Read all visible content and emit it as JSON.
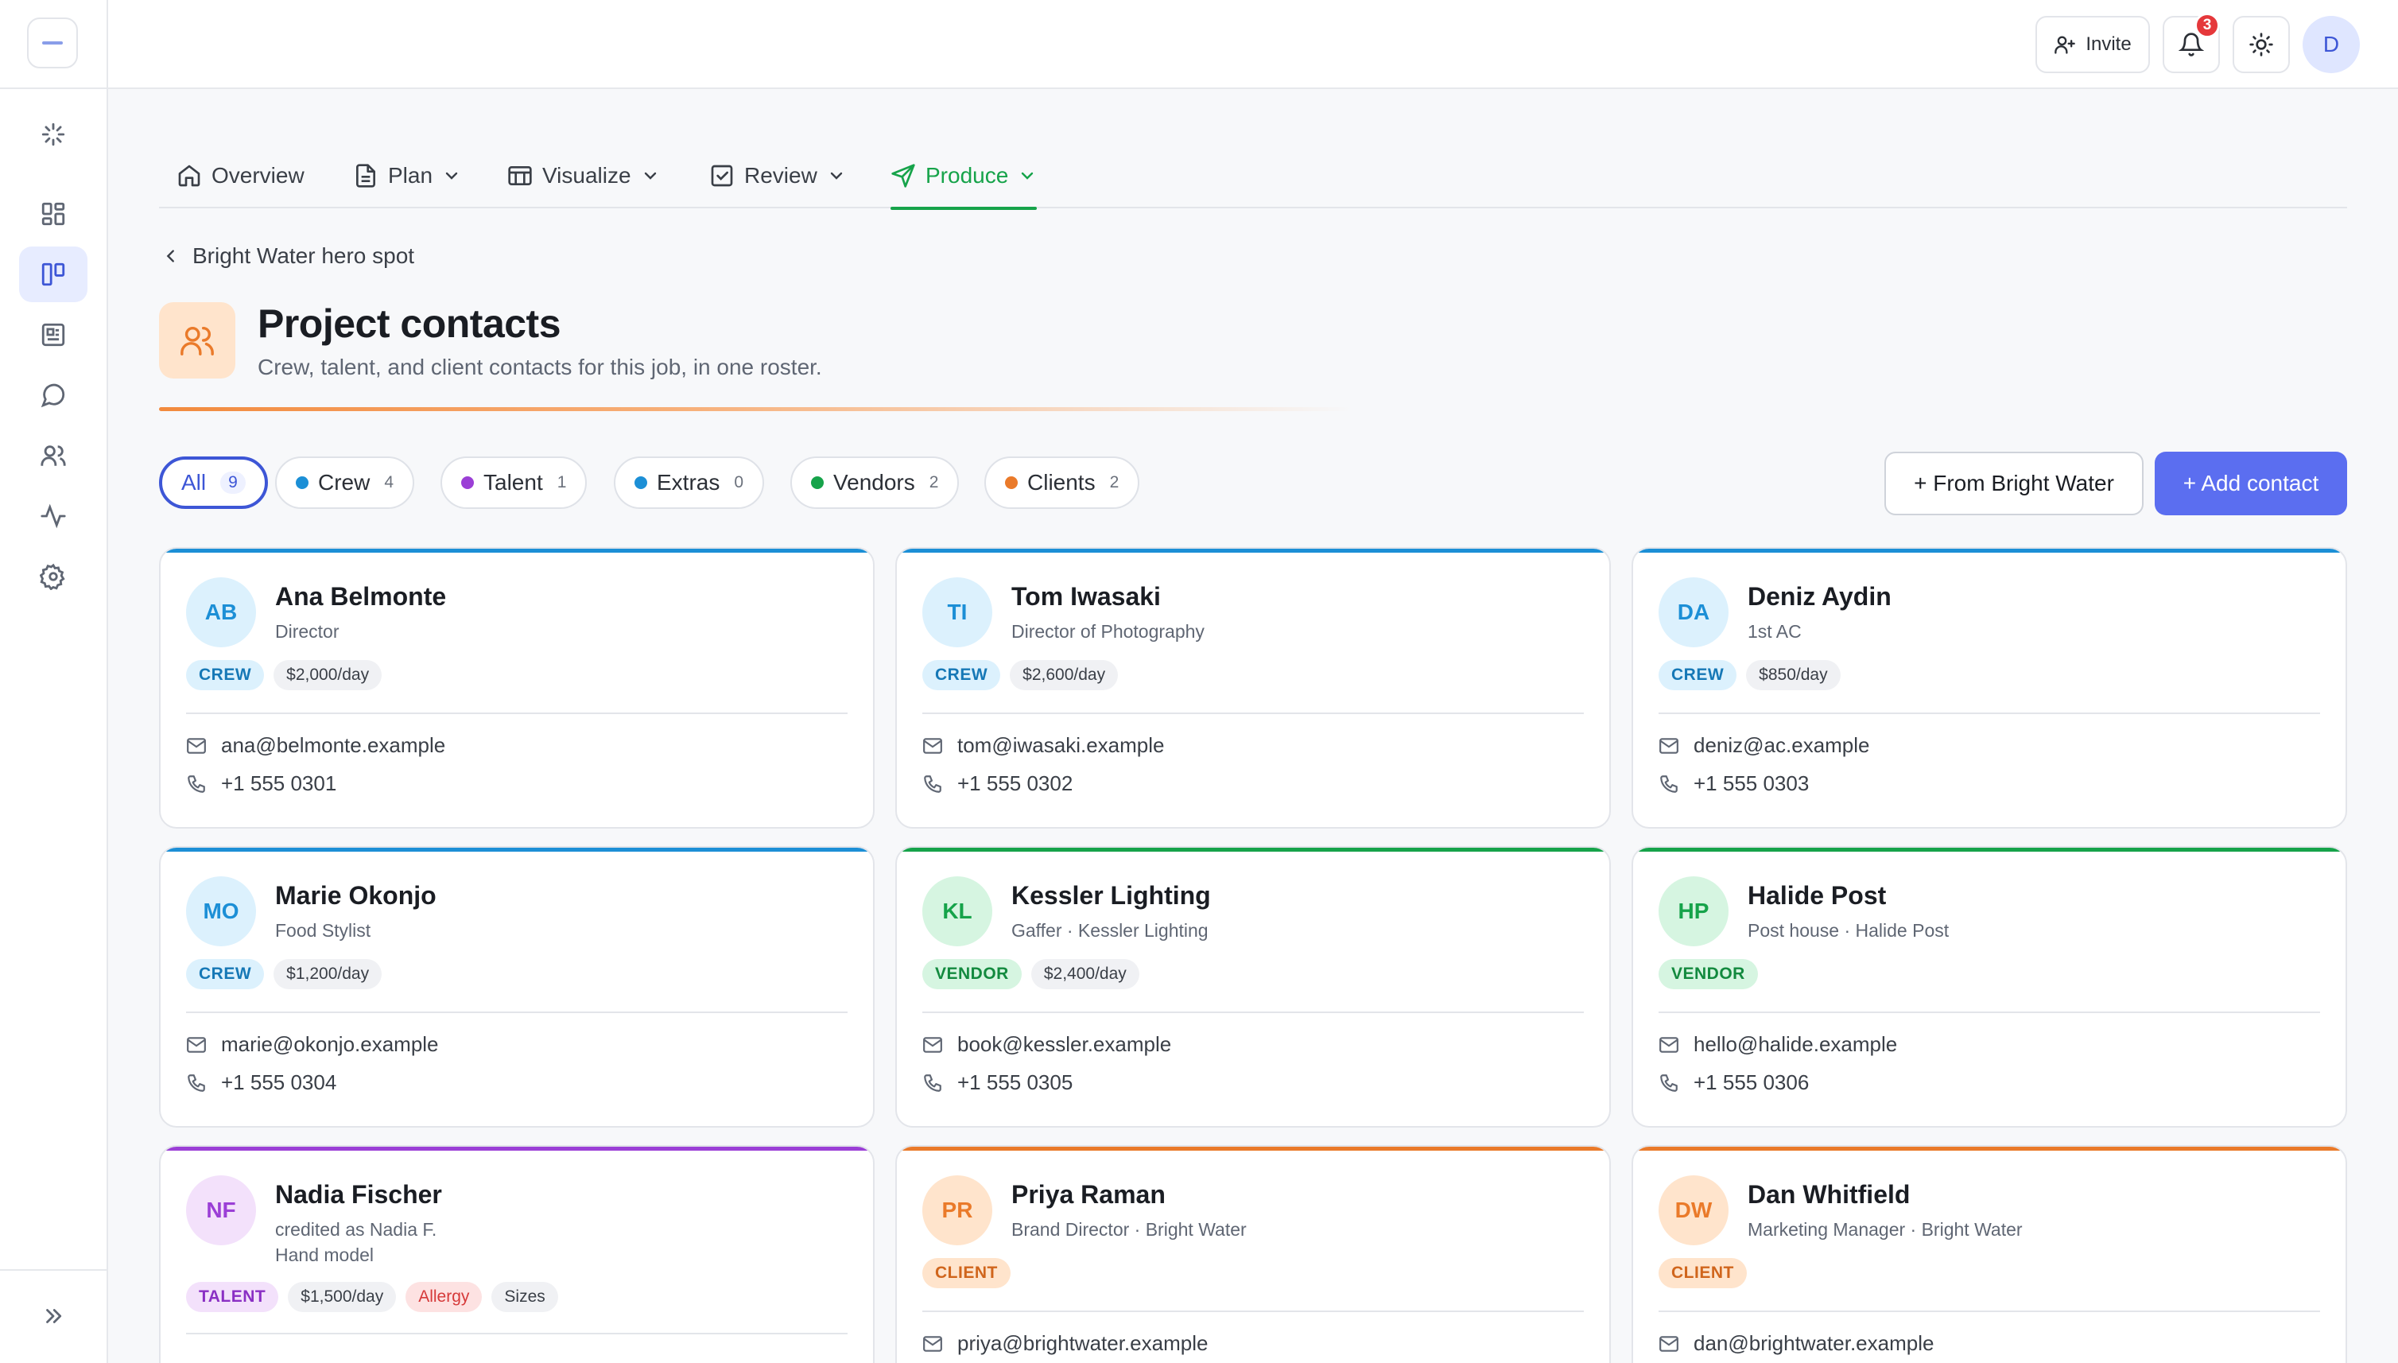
{
  "topbar": {
    "invite_label": "Invite",
    "notification_count": "3",
    "user_initial": "D"
  },
  "tabs": [
    {
      "label": "Overview",
      "icon": "home-icon"
    },
    {
      "label": "Plan",
      "icon": "document-icon"
    },
    {
      "label": "Visualize",
      "icon": "storyboard-icon"
    },
    {
      "label": "Review",
      "icon": "check-square-icon"
    },
    {
      "label": "Produce",
      "icon": "send-icon",
      "active": true
    }
  ],
  "breadcrumb": {
    "label": "Bright Water hero spot"
  },
  "header": {
    "title": "Project contacts",
    "subtitle": "Crew, talent, and client contacts for this job, in one roster."
  },
  "filters": [
    {
      "label": "All",
      "count": "9"
    },
    {
      "label": "Crew",
      "count": "4",
      "color": "#1c8fd6"
    },
    {
      "label": "Talent",
      "count": "1",
      "color": "#9b3fd6"
    },
    {
      "label": "Extras",
      "count": "0",
      "color": "#1c8fd6"
    },
    {
      "label": "Vendors",
      "count": "2",
      "color": "#16a34a"
    },
    {
      "label": "Clients",
      "count": "2",
      "color": "#ea7a2a"
    }
  ],
  "actions": {
    "from_bright_water": "+ From Bright Water",
    "add_contact": "+ Add contact"
  },
  "contacts": [
    {
      "initials": "AB",
      "name": "Ana Belmonte",
      "role": "Director",
      "type": "CREW",
      "rate": "$2,000/day",
      "email": "ana@belmonte.example",
      "phone": "+1 555 0301"
    },
    {
      "initials": "TI",
      "name": "Tom Iwasaki",
      "role": "Director of Photography",
      "type": "CREW",
      "rate": "$2,600/day",
      "email": "tom@iwasaki.example",
      "phone": "+1 555 0302"
    },
    {
      "initials": "DA",
      "name": "Deniz Aydin",
      "role": "1st AC",
      "type": "CREW",
      "rate": "$850/day",
      "email": "deniz@ac.example",
      "phone": "+1 555 0303"
    },
    {
      "initials": "MO",
      "name": "Marie Okonjo",
      "role": "Food Stylist",
      "type": "CREW",
      "rate": "$1,200/day",
      "email": "marie@okonjo.example",
      "phone": "+1 555 0304"
    },
    {
      "initials": "KL",
      "name": "Kessler Lighting",
      "role": "Gaffer · Kessler Lighting",
      "type": "VENDOR",
      "rate": "$2,400/day",
      "email": "book@kessler.example",
      "phone": "+1 555 0305"
    },
    {
      "initials": "HP",
      "name": "Halide Post",
      "role": "Post house · Halide Post",
      "type": "VENDOR",
      "email": "hello@halide.example",
      "phone": "+1 555 0306"
    },
    {
      "initials": "NF",
      "name": "Nadia Fischer",
      "role": "credited as Nadia F.",
      "role2": "Hand model",
      "type": "TALENT",
      "rate": "$1,500/day",
      "extra1": "Allergy",
      "extra2": "Sizes"
    },
    {
      "initials": "PR",
      "name": "Priya Raman",
      "role": "Brand Director · Bright Water",
      "type": "CLIENT",
      "email": "priya@brightwater.example"
    },
    {
      "initials": "DW",
      "name": "Dan Whitfield",
      "role": "Marketing Manager · Bright Water",
      "type": "CLIENT",
      "email": "dan@brightwater.example"
    }
  ],
  "colors": {
    "crew": "#1c8fd6",
    "vendor": "#16a34a",
    "talent": "#9b3fd6",
    "client": "#ea7a2a",
    "accent": "#5b6ef0"
  }
}
